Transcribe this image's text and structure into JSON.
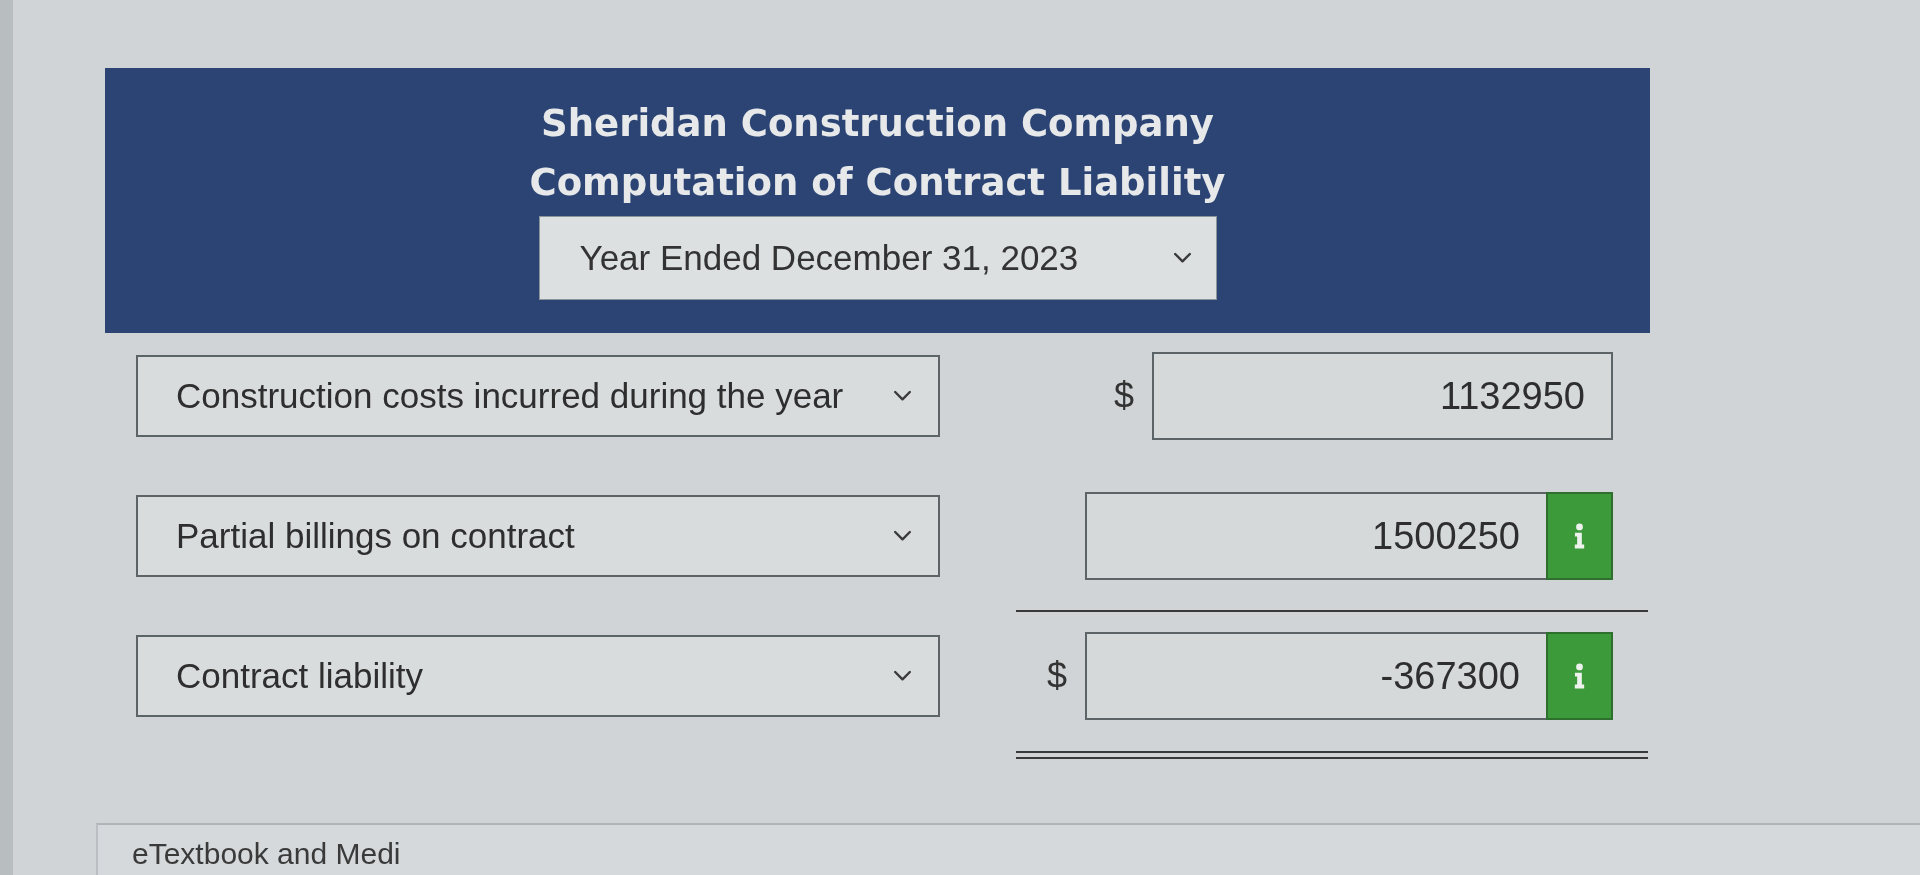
{
  "header": {
    "title": "Sheridan Construction Company",
    "subtitle": "Computation of Contract Liability",
    "period": {
      "value": "Year Ended December 31, 2023"
    }
  },
  "rows": [
    {
      "kind": "item",
      "label": "Construction costs incurred during the year",
      "currency": "$",
      "amount": "1132950",
      "info": false
    },
    {
      "kind": "subtotal",
      "label": "Partial billings on contract",
      "amount": "1500250",
      "info": true
    },
    {
      "kind": "total",
      "label": "Contract liability",
      "currency": "$",
      "amount": "-367300",
      "info": true
    }
  ],
  "section": {
    "title": "eTextbook and Medi"
  }
}
